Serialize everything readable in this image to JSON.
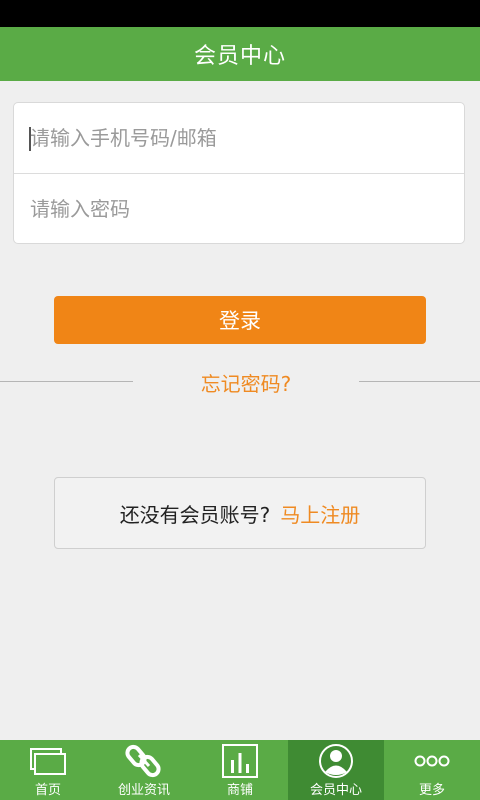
{
  "header": {
    "title": "会员中心"
  },
  "login_form": {
    "account_placeholder": "请输入手机号码/邮箱",
    "password_placeholder": "请输入密码",
    "login_label": "登录",
    "forgot_label": "忘记密码?"
  },
  "register": {
    "prompt": "还没有会员账号?",
    "link_label": "马上注册"
  },
  "tabs": [
    {
      "label": "首页",
      "icon": "home-icon",
      "active": false
    },
    {
      "label": "创业资讯",
      "icon": "link-icon",
      "active": false
    },
    {
      "label": "商铺",
      "icon": "chart-icon",
      "active": false
    },
    {
      "label": "会员中心",
      "icon": "user-icon",
      "active": true
    },
    {
      "label": "更多",
      "icon": "more-icon",
      "active": false
    }
  ],
  "colors": {
    "brand_green": "#5aab46",
    "active_tab": "#3f8b33",
    "accent_orange": "#f08516"
  }
}
